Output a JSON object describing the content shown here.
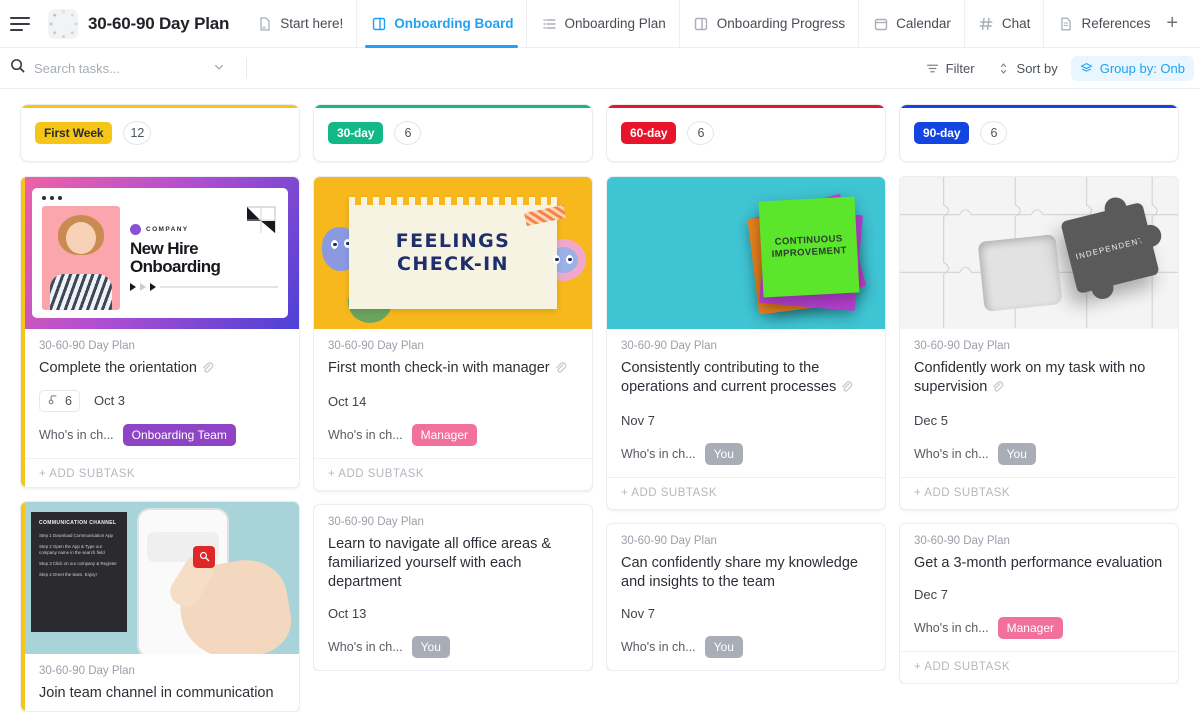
{
  "header": {
    "menu_icon": "hamburger-icon",
    "doc_icon": "loading-dots-icon",
    "title": "30-60-90 Day Plan",
    "add_tab_label": "+",
    "tabs": [
      {
        "label": "Start here!",
        "icon": "doc-home-icon",
        "active": false
      },
      {
        "label": "Onboarding Board",
        "icon": "board-icon",
        "active": true
      },
      {
        "label": "Onboarding Plan",
        "icon": "list-icon",
        "active": false
      },
      {
        "label": "Onboarding Progress",
        "icon": "board-icon",
        "active": false
      },
      {
        "label": "Calendar",
        "icon": "calendar-icon",
        "active": false
      },
      {
        "label": "Chat",
        "icon": "hash-icon",
        "active": false
      },
      {
        "label": "References",
        "icon": "doc-icon",
        "active": false
      }
    ]
  },
  "toolbar": {
    "search_placeholder": "Search tasks...",
    "search_value": "",
    "search_icon": "search-icon",
    "dropdown_icon": "chevron-down-icon",
    "filter_label": "Filter",
    "filter_icon": "filter-icon",
    "sort_label": "Sort by",
    "sort_icon": "sort-icon",
    "group_label": "Group by: Onb",
    "group_icon": "layers-icon",
    "accent_color": "#1fa2f3"
  },
  "board": {
    "columns": [
      {
        "status": "First Week",
        "status_color": "#f5c518",
        "status_text_color": "#2b2b33",
        "accent": "#f5c518",
        "count": "12",
        "cards": [
          {
            "cover": "new-hire-onboarding",
            "cover_text": {
              "company": "COMPANY",
              "heading_line1": "New Hire",
              "heading_line2": "Onboarding"
            },
            "crumb": "30-60-90 Day Plan",
            "title": "Complete the orientation",
            "attachment_icon": "paperclip-icon",
            "subtask_count": "6",
            "subtask_icon": "subtask-icon",
            "date": "Oct 3",
            "field_label": "Who's in ch...",
            "tag": "Onboarding Team",
            "tag_color": "#8e44c4",
            "add_subtask": "+ ADD SUBTASK"
          },
          {
            "cover": "communication-channel",
            "cover_text": {
              "heading": "COMMUNICATION CHANNEL",
              "steps": [
                "Step 1 Download Communication App",
                "Step 2 Open the App & Type our company name in the search field",
                "Step 3 Click on our company & Register",
                "Step 4 Greet the team. Enjoy!"
              ]
            },
            "crumb": "30-60-90 Day Plan",
            "title": "Join team channel in communication",
            "attachment_icon": "",
            "subtask_count": "",
            "date": "",
            "field_label": "",
            "tag": "",
            "tag_color": "",
            "add_subtask": ""
          }
        ]
      },
      {
        "status": "30-day",
        "status_color": "#12b886",
        "status_text_color": "#ffffff",
        "accent": "#12b886",
        "count": "6",
        "cards": [
          {
            "cover": "feelings-check-in",
            "cover_text": {
              "heading_line1": "FEELINGS",
              "heading_line2": "CHECK-IN"
            },
            "crumb": "30-60-90 Day Plan",
            "title": "First month check-in with manager",
            "attachment_icon": "paperclip-icon",
            "subtask_count": "",
            "date": "Oct 14",
            "field_label": "Who's in ch...",
            "tag": "Manager",
            "tag_color": "#f2709c",
            "add_subtask": "+ ADD SUBTASK"
          },
          {
            "cover": "",
            "crumb": "30-60-90 Day Plan",
            "title": "Learn to navigate all office areas & familiarized yourself with each department",
            "attachment_icon": "",
            "subtask_count": "",
            "date": "Oct 13",
            "field_label": "Who's in ch...",
            "tag": "You",
            "tag_color": "#a9aeb6",
            "add_subtask": ""
          }
        ]
      },
      {
        "status": "60-day",
        "status_color": "#e8142b",
        "status_text_color": "#ffffff",
        "accent": "#e8142b",
        "count": "6",
        "cards": [
          {
            "cover": "continuous-improvement",
            "cover_text": {
              "heading": "CONTINUOUS IMPROVEMENT"
            },
            "crumb": "30-60-90 Day Plan",
            "title": "Consistently contributing to the operations and current processes",
            "attachment_icon": "paperclip-icon",
            "subtask_count": "",
            "date": "Nov 7",
            "field_label": "Who's in ch...",
            "tag": "You",
            "tag_color": "#a9aeb6",
            "add_subtask": "+ ADD SUBTASK"
          },
          {
            "cover": "",
            "crumb": "30-60-90 Day Plan",
            "title": "Can confidently share my knowledge and insights to the team",
            "attachment_icon": "",
            "subtask_count": "",
            "date": "Nov 7",
            "field_label": "Who's in ch...",
            "tag": "You",
            "tag_color": "#a9aeb6",
            "add_subtask": ""
          }
        ]
      },
      {
        "status": "90-day",
        "status_color": "#1445e0",
        "status_text_color": "#ffffff",
        "accent": "#1445e0",
        "count": "6",
        "cards": [
          {
            "cover": "independent-puzzle",
            "cover_text": {
              "heading": "INDEPENDENT"
            },
            "crumb": "30-60-90 Day Plan",
            "title": "Confidently work on my task with no supervision",
            "attachment_icon": "paperclip-icon",
            "subtask_count": "",
            "date": "Dec 5",
            "field_label": "Who's in ch...",
            "tag": "You",
            "tag_color": "#a9aeb6",
            "add_subtask": "+ ADD SUBTASK"
          },
          {
            "cover": "",
            "crumb": "30-60-90 Day Plan",
            "title": "Get a 3-month performance evaluation",
            "attachment_icon": "",
            "subtask_count": "",
            "date": "Dec 7",
            "field_label": "Who's in ch...",
            "tag": "Manager",
            "tag_color": "#f2709c",
            "add_subtask": "+ ADD SUBTASK"
          }
        ]
      }
    ]
  }
}
